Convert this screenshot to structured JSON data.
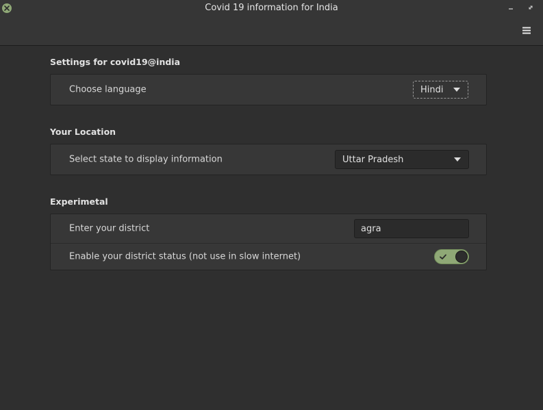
{
  "window": {
    "title": "Covid 19 information for India"
  },
  "icons": {
    "close": "close-icon",
    "minimize": "minimize-icon",
    "maximize": "maximize-icon",
    "menu": "hamburger-menu-icon",
    "dropdown": "chevron-down-icon",
    "check": "checkmark-icon"
  },
  "colors": {
    "accent": "#8fa876",
    "background": "#2f2f2f",
    "group_background": "#373737"
  },
  "sections": {
    "settings": {
      "title": "Settings for covid19@india",
      "language_label": "Choose language",
      "language_value": "Hindi"
    },
    "location": {
      "title": "Your Location",
      "state_label": "Select state to display information",
      "state_value": "Uttar Pradesh"
    },
    "experimental": {
      "title": "Experimetal",
      "district_label": "Enter your district",
      "district_value": "agra",
      "district_status_label": "Enable your district status (not use in slow internet)",
      "district_status_enabled": true
    }
  }
}
